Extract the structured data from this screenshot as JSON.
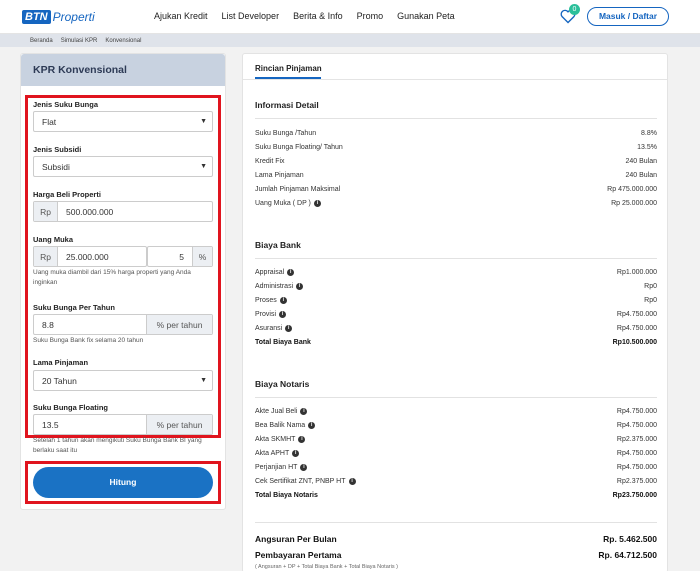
{
  "header": {
    "logo_mark": "BTN",
    "logo_text": "Properti",
    "nav": [
      "Ajukan Kredit",
      "List Developer",
      "Berita & Info",
      "Promo",
      "Gunakan Peta"
    ],
    "favorites_count": "0",
    "login_label": "Masuk / Daftar"
  },
  "breadcrumb": [
    "Beranda",
    "Simulasi KPR",
    "Konvensional"
  ],
  "form": {
    "title": "KPR Konvensional",
    "jenis_suku_bunga": {
      "label": "Jenis Suku Bunga",
      "value": "Flat"
    },
    "jenis_subsidi": {
      "label": "Jenis Subsidi",
      "value": "Subsidi"
    },
    "harga_beli": {
      "label": "Harga Beli Properti",
      "prefix": "Rp",
      "value": "500.000.000"
    },
    "uang_muka": {
      "label": "Uang Muka",
      "prefix": "Rp",
      "value": "25.000.000",
      "percent": "5",
      "percent_suffix": "%",
      "hint": "Uang muka diambil dari 15% harga properti yang Anda inginkan"
    },
    "suku_bunga": {
      "label": "Suku Bunga Per Tahun",
      "value": "8.8",
      "suffix": "% per tahun",
      "hint": "Suku Bunga Bank fix selama 20 tahun"
    },
    "lama_pinjaman": {
      "label": "Lama Pinjaman",
      "value": "20 Tahun"
    },
    "suku_bunga_floating": {
      "label": "Suku Bunga Floating",
      "value": "13.5",
      "suffix": "% per tahun",
      "hint": "Setelah 1 tahun akan mengikuti Suku Bunga Bank BI yang berlaku saat itu"
    },
    "submit_label": "Hitung"
  },
  "details": {
    "tab_label": "Rincian Pinjaman",
    "info_title": "Informasi Detail",
    "info_rows": [
      {
        "label": "Suku Bunga /Tahun",
        "value": "8.8%"
      },
      {
        "label": "Suku Bunga Floating/ Tahun",
        "value": "13.5%"
      },
      {
        "label": "Kredit Fix",
        "value": "240 Bulan"
      },
      {
        "label": "Lama Pinjaman",
        "value": "240 Bulan"
      },
      {
        "label": "Jumlah Pinjaman Maksimal",
        "value": "Rp 475.000.000"
      },
      {
        "label": "Uang Muka ( DP )",
        "value": "Rp 25.000.000"
      }
    ],
    "bank_title": "Biaya Bank",
    "bank_rows": [
      {
        "label": "Appraisal",
        "value": "Rp1.000.000"
      },
      {
        "label": "Administrasi",
        "value": "Rp0"
      },
      {
        "label": "Proses",
        "value": "Rp0"
      },
      {
        "label": "Provisi",
        "value": "Rp4.750.000"
      },
      {
        "label": "Asuransi",
        "value": "Rp4.750.000"
      }
    ],
    "bank_total": {
      "label": "Total Biaya Bank",
      "value": "Rp10.500.000"
    },
    "notaris_title": "Biaya Notaris",
    "notaris_rows": [
      {
        "label": "Akte Jual Beli",
        "value": "Rp4.750.000"
      },
      {
        "label": "Bea Balik Nama",
        "value": "Rp4.750.000"
      },
      {
        "label": "Akta SKMHT",
        "value": "Rp2.375.000"
      },
      {
        "label": "Akta APHT",
        "value": "Rp4.750.000"
      },
      {
        "label": "Perjanjian HT",
        "value": "Rp4.750.000"
      },
      {
        "label": "Cek Sertifikat ZNT, PNBP HT",
        "value": "Rp2.375.000"
      }
    ],
    "notaris_total": {
      "label": "Total Biaya Notaris",
      "value": "Rp23.750.000"
    },
    "angsuran": {
      "label": "Angsuran Per Bulan",
      "value": "Rp. 5.462.500"
    },
    "pembayaran": {
      "label": "Pembayaran Pertama",
      "value": "Rp. 64.712.500"
    },
    "footnote": "( Angsuran + DP + Total Biaya Bank + Total Biaya Notaris )"
  },
  "colors": {
    "brand": "#1565c0",
    "button": "#1a72c4",
    "highlight": "#e0141e",
    "badge": "#2bbf9a"
  }
}
